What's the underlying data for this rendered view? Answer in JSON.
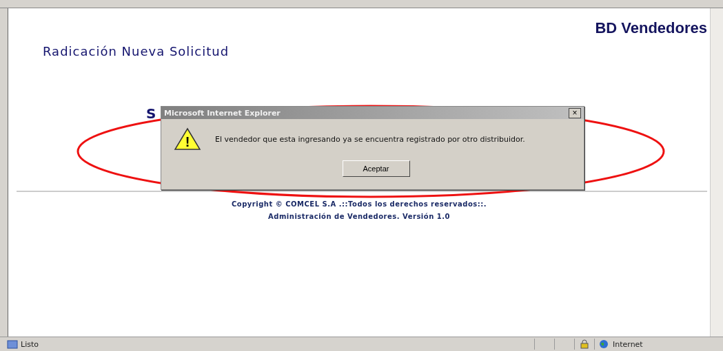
{
  "page": {
    "brand": "BD Vendedores",
    "heading": "Radicación Nueva Solicitud",
    "hidden_heading": "S",
    "footer": [
      "Copyright © COMCEL S.A .::Todos los derechos reservados::.",
      "Administración de Vendedores. Versión 1.0"
    ]
  },
  "dialog": {
    "title": "Microsoft Internet Explorer",
    "close": "×",
    "message": "El vendedor que esta ingresando ya se encuentra registrado por otro distribuidor.",
    "icon_mark": "!",
    "button": "Aceptar"
  },
  "status_bar": {
    "text": "Listo",
    "zone": "Internet"
  }
}
